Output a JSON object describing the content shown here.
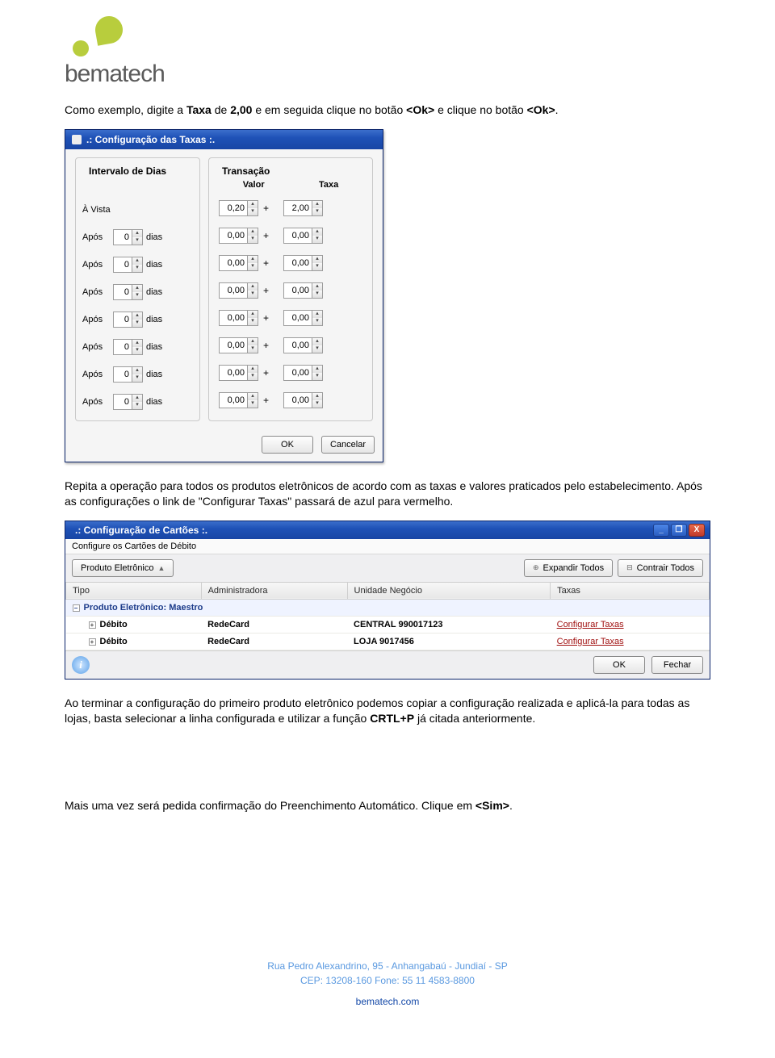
{
  "logo": {
    "text": "bematech"
  },
  "para1_pre": "Como exemplo, digite a ",
  "para1_b1": "Taxa",
  "para1_mid": " de ",
  "para1_b2": "2,00",
  "para1_mid2": " e em seguida clique no botão ",
  "para1_b3": "<Ok>",
  "para1_mid3": " e clique no botão ",
  "para1_b4": "<Ok>",
  "para1_end": ".",
  "dlg1": {
    "title": ".: Configuração das Taxas :.",
    "panel_intervalo": "Intervalo de Dias",
    "panel_transacao": "Transação",
    "col_valor": "Valor",
    "col_taxa": "Taxa",
    "avista": "À Vista",
    "apos": "Após",
    "dias": "dias",
    "plus": "+",
    "ok": "OK",
    "cancel": "Cancelar",
    "rows": [
      {
        "label_type": "avista",
        "d": "",
        "valor": "0,20",
        "taxa": "2,00"
      },
      {
        "label_type": "apos",
        "d": "0",
        "valor": "0,00",
        "taxa": "0,00"
      },
      {
        "label_type": "apos",
        "d": "0",
        "valor": "0,00",
        "taxa": "0,00"
      },
      {
        "label_type": "apos",
        "d": "0",
        "valor": "0,00",
        "taxa": "0,00"
      },
      {
        "label_type": "apos",
        "d": "0",
        "valor": "0,00",
        "taxa": "0,00"
      },
      {
        "label_type": "apos",
        "d": "0",
        "valor": "0,00",
        "taxa": "0,00"
      },
      {
        "label_type": "apos",
        "d": "0",
        "valor": "0,00",
        "taxa": "0,00"
      },
      {
        "label_type": "apos",
        "d": "0",
        "valor": "0,00",
        "taxa": "0,00"
      }
    ]
  },
  "para2": "Repita a operação para todos os produtos eletrônicos de acordo com as taxas e valores praticados pelo estabelecimento. Após as configurações o link de \"Configurar Taxas\" passará de azul para vermelho.",
  "dlg2": {
    "title": ".: Configuração de Cartões :.",
    "subtitle": "Configure os Cartões de Débito",
    "produto_btn": "Produto Eletrônico",
    "expandir": "Expandir Todos",
    "contrair": "Contrair Todos",
    "th": {
      "tipo": "Tipo",
      "admin": "Administradora",
      "un": "Unidade Negócio",
      "taxas": "Taxas"
    },
    "group": "Produto Eletrônico: Maestro",
    "rows": [
      {
        "tipo": "Débito",
        "admin": "RedeCard",
        "un": "CENTRAL 990017123",
        "taxas": "Configurar Taxas"
      },
      {
        "tipo": "Débito",
        "admin": "RedeCard",
        "un": "LOJA 9017456",
        "taxas": "Configurar Taxas"
      }
    ],
    "ok": "OK",
    "fechar": "Fechar"
  },
  "para3_pre": "Ao terminar a configuração do primeiro produto eletrônico podemos copiar a configuração realizada e aplicá-la para todas as lojas, basta selecionar a linha configurada e utilizar a função ",
  "para3_b": "CRTL+P",
  "para3_end": " já citada anteriormente.",
  "para4_pre": "Mais uma vez será pedida confirmação do Preenchimento Automático. Clique em ",
  "para4_b": "<Sim>",
  "para4_end": ".",
  "footer": {
    "line1": "Rua Pedro Alexandrino, 95 - Anhangabaú - Jundiaí - SP",
    "line2": "CEP: 13208-160   Fone: 55 11 4583-8800",
    "site": "bematech.com"
  }
}
